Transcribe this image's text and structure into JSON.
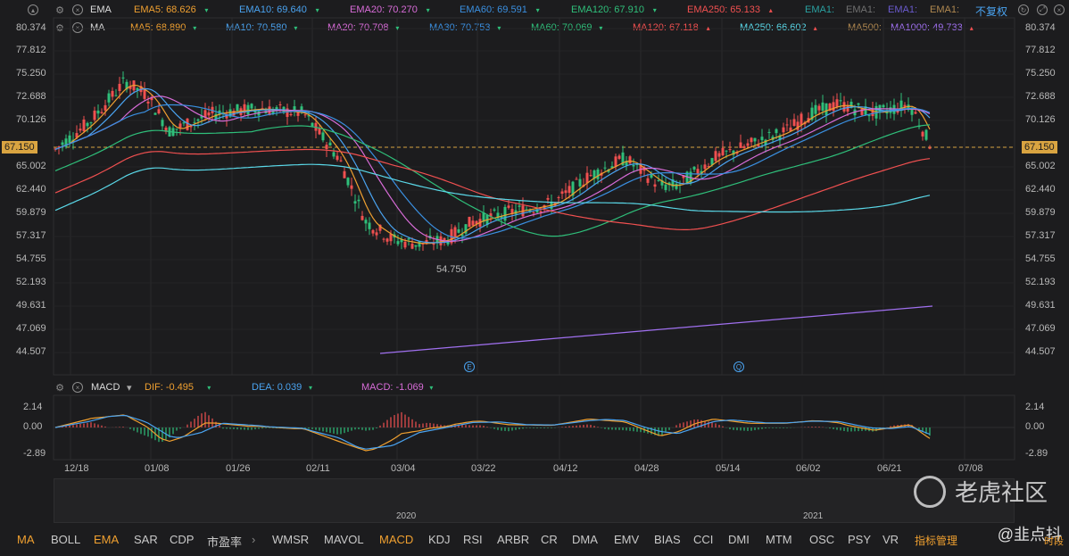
{
  "ema_row": {
    "name": "EMA",
    "items": [
      {
        "label": "EMA5: 68.626",
        "dir": "▾",
        "color": "#f0a030"
      },
      {
        "label": "EMA10: 69.640",
        "dir": "▾",
        "color": "#4aa3f0"
      },
      {
        "label": "EMA20: 70.270",
        "dir": "▾",
        "color": "#d86cd8"
      },
      {
        "label": "EMA60: 69.591",
        "dir": "▾",
        "color": "#3a8fe0"
      },
      {
        "label": "EMA120: 67.910",
        "dir": "▾",
        "color": "#2fbf7a"
      },
      {
        "label": "EMA250: 65.133",
        "dir": "▴",
        "color": "#f05050"
      },
      {
        "label": "EMA1:",
        "dir": "",
        "color": "#2aa1a1"
      },
      {
        "label": "EMA1:",
        "dir": "",
        "color": "#707070"
      },
      {
        "label": "EMA1:",
        "dir": "",
        "color": "#6a5acd"
      },
      {
        "label": "EMA1:",
        "dir": "",
        "color": "#b08850"
      }
    ],
    "adjust_label": "不复权"
  },
  "ma_row": {
    "name": "MA",
    "items": [
      {
        "label": "MA5: 68.890",
        "dir": "▾",
        "color": "#f0a030"
      },
      {
        "label": "MA10: 70.580",
        "dir": "▾",
        "color": "#4aa3f0"
      },
      {
        "label": "MA20: 70.708",
        "dir": "▾",
        "color": "#d86cd8"
      },
      {
        "label": "MA30: 70.753",
        "dir": "▾",
        "color": "#3a8fe0"
      },
      {
        "label": "MA60: 70.069",
        "dir": "▾",
        "color": "#2fbf7a"
      },
      {
        "label": "MA120: 67.118",
        "dir": "▴",
        "color": "#f05050"
      },
      {
        "label": "MA250: 66.602",
        "dir": "▴",
        "color": "#5ad8e8"
      },
      {
        "label": "MA500:",
        "dir": "",
        "color": "#b08850"
      },
      {
        "label": "MA1000: 49.733",
        "dir": "▴",
        "color": "#a070f0"
      }
    ]
  },
  "macd_row": {
    "name": "MACD",
    "items": [
      {
        "label": "DIF: -0.495",
        "dir": "▾",
        "color": "#f0a030"
      },
      {
        "label": "DEA: 0.039",
        "dir": "▾",
        "color": "#4aa3f0"
      },
      {
        "label": "MACD: -1.069",
        "dir": "▾",
        "color": "#d86cd8"
      }
    ]
  },
  "price_axis": [
    "80.374",
    "77.812",
    "75.250",
    "72.688",
    "70.126",
    "67.150",
    "65.002",
    "62.440",
    "59.879",
    "57.317",
    "54.755",
    "52.193",
    "49.631",
    "47.069",
    "44.507"
  ],
  "last_price": "67.150",
  "low_marker": "54.750",
  "macd_axis": [
    "2.14",
    "0.00",
    "-2.89"
  ],
  "dates": [
    "12/18",
    "01/08",
    "01/26",
    "02/11",
    "03/04",
    "03/22",
    "04/12",
    "04/28",
    "05/14",
    "06/02",
    "06/21",
    "07/08"
  ],
  "event_markers": [
    "E",
    "Q"
  ],
  "years": [
    "2020",
    "2021"
  ],
  "indicator_tabs": [
    "MA",
    "BOLL",
    "EMA",
    "SAR",
    "CDP",
    "市盈率",
    "WMSR",
    "MAVOL",
    "MACD",
    "KDJ",
    "RSI",
    "ARBR",
    "CR",
    "DMA",
    "EMV",
    "BIAS",
    "CCI",
    "DMI",
    "MTM",
    "OSC",
    "PSY",
    "VR",
    "指标管理"
  ],
  "active_tabs": [
    "MA",
    "EMA",
    "MACD",
    "指标管理"
  ],
  "watermark": {
    "brand": "老虎社区",
    "user": "@韭点抖",
    "extra": "时段"
  },
  "colors": {
    "up": "#f05050",
    "down": "#2fbf7a",
    "bg": "#1c1c1e",
    "accent": "#f0a030"
  }
}
